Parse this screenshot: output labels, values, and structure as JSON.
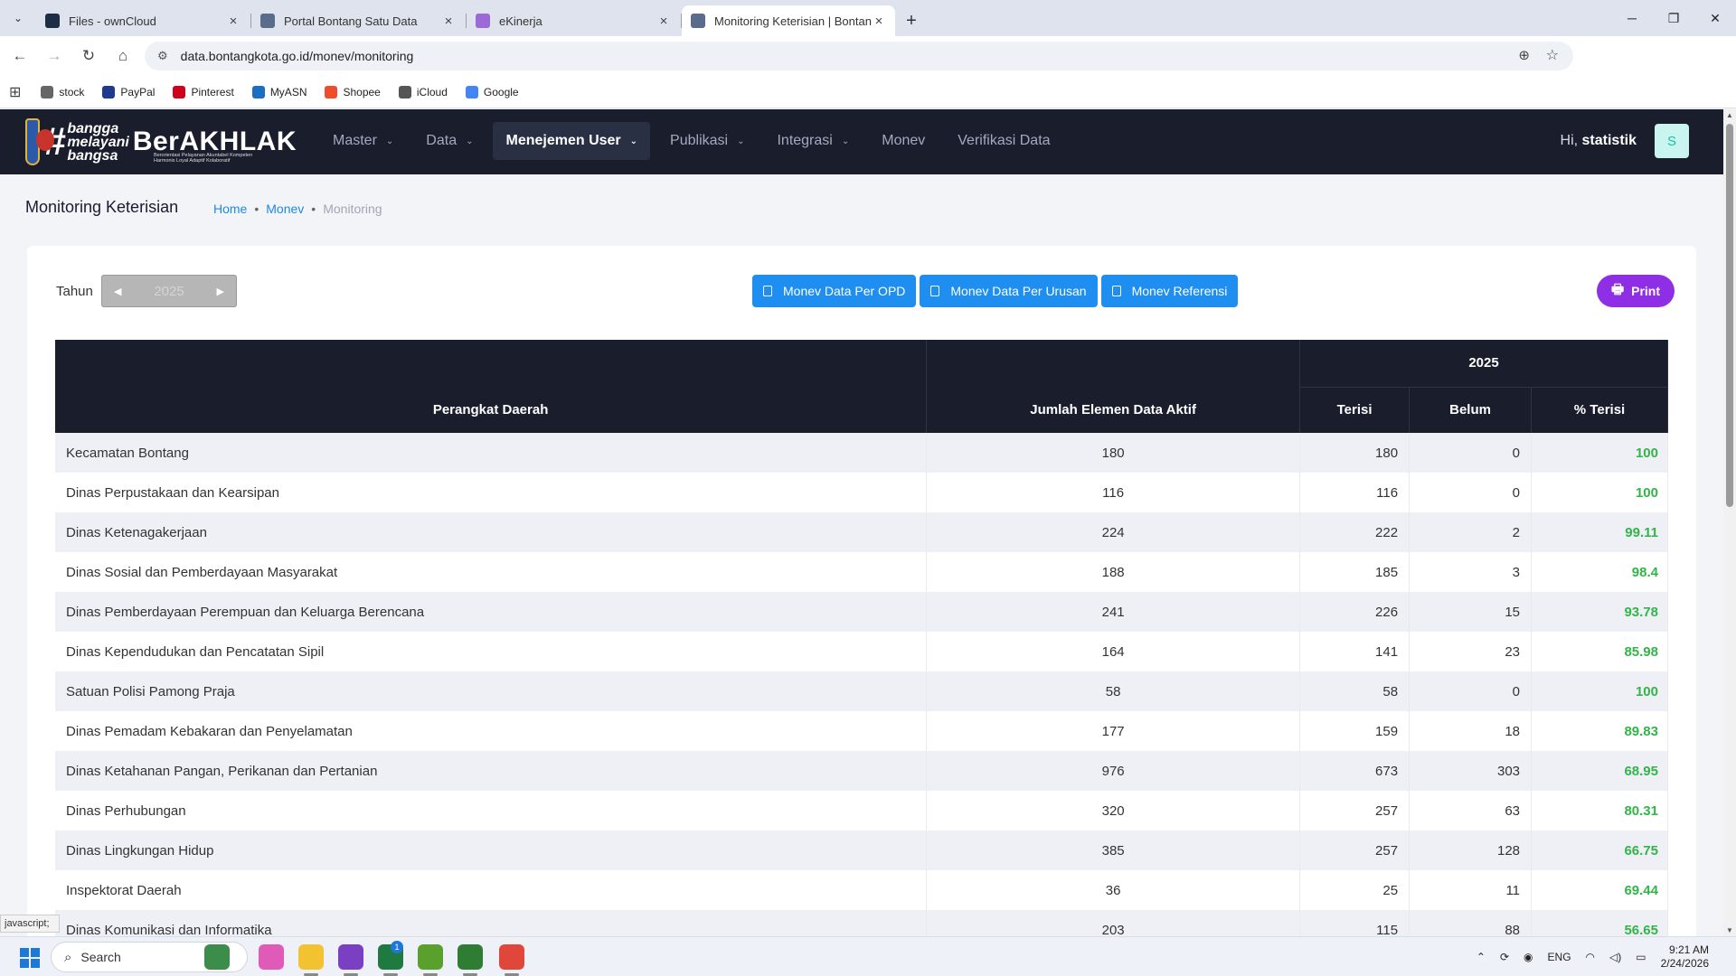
{
  "browser": {
    "tabs": [
      {
        "title": "Files - ownCloud",
        "color": "#1d2d44",
        "active": false
      },
      {
        "title": "Portal Bontang Satu Data",
        "color": "#5a6b8c",
        "active": false
      },
      {
        "title": "eKinerja",
        "color": "#9c6ad6",
        "active": false
      },
      {
        "title": "Monitoring Keterisian | Bontang",
        "color": "#5a6b8c",
        "active": true
      }
    ],
    "new_tab": "+",
    "url": "data.bontangkota.go.id/monev/monitoring",
    "bookmarks": [
      {
        "label": "stock",
        "icon": "folder-icon",
        "color": "#666"
      },
      {
        "label": "PayPal",
        "icon": "paypal-icon",
        "color": "#203a8f"
      },
      {
        "label": "Pinterest",
        "icon": "pinterest-icon",
        "color": "#d0021b"
      },
      {
        "label": "MyASN",
        "icon": "myasn-icon",
        "color": "#1b6ec2"
      },
      {
        "label": "Shopee",
        "icon": "shopee-icon",
        "color": "#ee4d2d"
      },
      {
        "label": "iCloud",
        "icon": "apple-icon",
        "color": "#555"
      },
      {
        "label": "Google",
        "icon": "google-icon",
        "color": "#4285f4"
      }
    ]
  },
  "site": {
    "logo_hash": "#",
    "logo_line1": "bangga",
    "logo_line2": "melayani",
    "logo_line3": "bangsa",
    "logo_brand": "BerAKHLAK",
    "logo_sub1": "Berorientasi Pelayanan Akuntabel Kompeten",
    "logo_sub2": "Harmonis Loyal Adaptif Kolaboratif",
    "menu": [
      {
        "label": "Master",
        "dropdown": true,
        "active": false
      },
      {
        "label": "Data",
        "dropdown": true,
        "active": false
      },
      {
        "label": "Menejemen User",
        "dropdown": true,
        "active": true
      },
      {
        "label": "Publikasi",
        "dropdown": true,
        "active": false
      },
      {
        "label": "Integrasi",
        "dropdown": true,
        "active": false
      },
      {
        "label": "Monev",
        "dropdown": false,
        "active": false
      },
      {
        "label": "Verifikasi Data",
        "dropdown": false,
        "active": false
      }
    ],
    "greeting_prefix": "Hi,",
    "username": "statistik",
    "avatar_letter": "S"
  },
  "page": {
    "title": "Monitoring Keterisian",
    "breadcrumb": [
      "Home",
      "Monev",
      "Monitoring"
    ],
    "tahun_label": "Tahun",
    "year": "2025",
    "buttons": [
      "Monev Data Per OPD",
      "Monev Data Per Urusan",
      "Monev Referensi"
    ],
    "print_label": "Print"
  },
  "table": {
    "headers": {
      "perangkat": "Perangkat Daerah",
      "jumlah": "Jumlah Elemen Data Aktif",
      "year": "2025",
      "terisi": "Terisi",
      "belum": "Belum",
      "persen": "% Terisi"
    },
    "rows": [
      {
        "name": "Kecamatan Bontang",
        "jumlah": "180",
        "terisi": "180",
        "belum": "0",
        "persen": "100"
      },
      {
        "name": "Dinas Perpustakaan dan Kearsipan",
        "jumlah": "116",
        "terisi": "116",
        "belum": "0",
        "persen": "100"
      },
      {
        "name": "Dinas Ketenagakerjaan",
        "jumlah": "224",
        "terisi": "222",
        "belum": "2",
        "persen": "99.11"
      },
      {
        "name": "Dinas Sosial dan Pemberdayaan Masyarakat",
        "jumlah": "188",
        "terisi": "185",
        "belum": "3",
        "persen": "98.4"
      },
      {
        "name": "Dinas Pemberdayaan Perempuan dan Keluarga Berencana",
        "jumlah": "241",
        "terisi": "226",
        "belum": "15",
        "persen": "93.78"
      },
      {
        "name": "Dinas Kependudukan dan Pencatatan Sipil",
        "jumlah": "164",
        "terisi": "141",
        "belum": "23",
        "persen": "85.98"
      },
      {
        "name": "Satuan Polisi Pamong Praja",
        "jumlah": "58",
        "terisi": "58",
        "belum": "0",
        "persen": "100"
      },
      {
        "name": "Dinas Pemadam Kebakaran dan Penyelamatan",
        "jumlah": "177",
        "terisi": "159",
        "belum": "18",
        "persen": "89.83"
      },
      {
        "name": "Dinas Ketahanan Pangan, Perikanan dan Pertanian",
        "jumlah": "976",
        "terisi": "673",
        "belum": "303",
        "persen": "68.95"
      },
      {
        "name": "Dinas Perhubungan",
        "jumlah": "320",
        "terisi": "257",
        "belum": "63",
        "persen": "80.31"
      },
      {
        "name": "Dinas Lingkungan Hidup",
        "jumlah": "385",
        "terisi": "257",
        "belum": "128",
        "persen": "66.75"
      },
      {
        "name": "Inspektorat Daerah",
        "jumlah": "36",
        "terisi": "25",
        "belum": "11",
        "persen": "69.44"
      },
      {
        "name": "Dinas Komunikasi dan Informatika",
        "jumlah": "203",
        "terisi": "115",
        "belum": "88",
        "persen": "56.65"
      }
    ]
  },
  "status_tip": "javascript;",
  "taskbar": {
    "search_placeholder": "Search",
    "apps": [
      {
        "name": "widgets-app",
        "color": "#3c8d4a"
      },
      {
        "name": "copilot-app",
        "color": "#e05ab8"
      },
      {
        "name": "file-explorer-app",
        "color": "#f2c230"
      },
      {
        "name": "purple-app",
        "color": "#7a3fc2"
      },
      {
        "name": "excel-app",
        "color": "#1f7a3f"
      },
      {
        "name": "excel-task-app",
        "color": "#5aa02c"
      },
      {
        "name": "hs-app",
        "color": "#2e7d32"
      },
      {
        "name": "chrome-app",
        "color": "#e0463a"
      }
    ],
    "excel_badge": "1",
    "language": "ENG",
    "time": "9:21 AM",
    "date": "2/24/2026"
  }
}
